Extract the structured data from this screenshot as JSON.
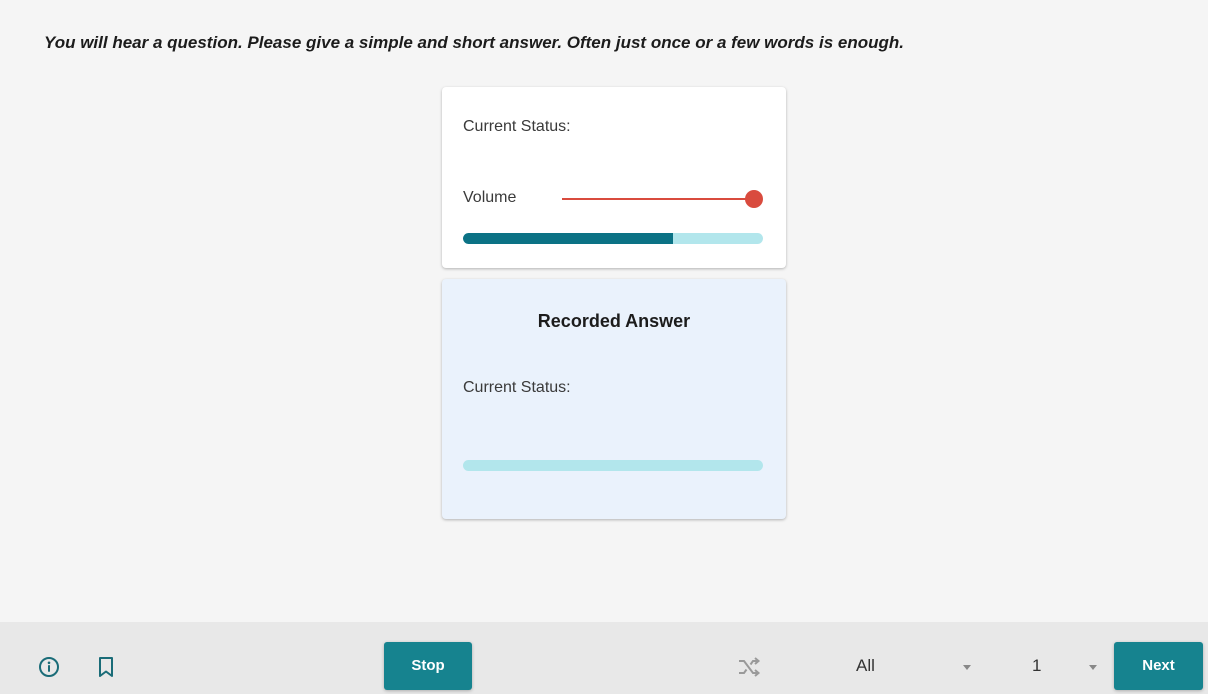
{
  "instruction": "You will hear a question. Please give a simple and short answer. Often just once or a few words is enough.",
  "status_card": {
    "status_label": "Current Status:",
    "volume_label": "Volume",
    "volume_level": 1.0,
    "progress_fraction": 0.7
  },
  "answer_card": {
    "title": "Recorded Answer",
    "status_label": "Current Status:",
    "progress_fraction": 0.0
  },
  "bottom_bar": {
    "info_icon": "info-icon",
    "bookmark_icon": "bookmark-icon",
    "stop_label": "Stop",
    "shuffle_icon": "shuffle-icon",
    "mode_select_value": "All",
    "page_select_value": "1",
    "next_label": "Next"
  },
  "colors": {
    "accent": "#16838f",
    "progress_fill": "#0b7285",
    "progress_track": "#b2e6ec",
    "slider": "#d94b3e",
    "answer_card_bg": "#eaf2fc"
  }
}
